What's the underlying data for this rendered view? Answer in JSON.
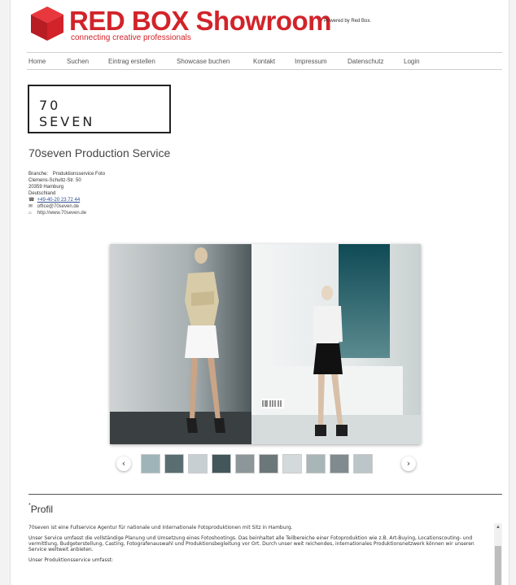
{
  "header": {
    "brand": "RED BOX Showroom",
    "tagline": "connecting creative professionals",
    "powered_by": "Powered by Red Box.",
    "brand_color": "#d2232a"
  },
  "nav": {
    "items": [
      "Home",
      "Suchen",
      "Eintrag erstellen",
      "Showcase buchen",
      "Kontakt",
      "Impressum",
      "Datenschutz",
      "Login"
    ]
  },
  "company": {
    "logo_line1": "70",
    "logo_line2": "SEVEN",
    "title": "70seven Production Service",
    "branche_label": "Branche:",
    "branche_value": "Produktionsservice Foto",
    "street": "Clemens-Schultz-Str. 50",
    "city": "20359 Hamburg",
    "country": "Deutschland",
    "phone": "+49-40-20 23 72 44",
    "email": "office@70seven.de",
    "website": "http://www.70seven.de"
  },
  "gallery": {
    "prev_icon": "chevron-left-icon",
    "next_icon": "chevron-right-icon",
    "prev_glyph": "‹",
    "next_glyph": "›",
    "thumbnail_count": 10
  },
  "profil": {
    "heading": "Profil",
    "star": "*",
    "p1": "70seven ist eine Fullservice Agentur für nationale und internationale Fotoproduktionen mit Sitz in Hamburg.",
    "p2": "Unser Service umfasst die vollständige Planung und Umsetzung eines Fotoshootings. Das beinhaltet alle Teilbereiche einer Fotoproduktion wie z.B. Art-Buying, Locationscouting- und vermittlung, Budgeterstellung, Casting, Fotografenauswahl und Produktionsbegleitung vor Ort. Durch unser weit reichendes, internationales Produktionsnetzwerk können wir unseren Service weltweit anbieten.",
    "p3": "Unser Produktionsservice umfasst:"
  }
}
